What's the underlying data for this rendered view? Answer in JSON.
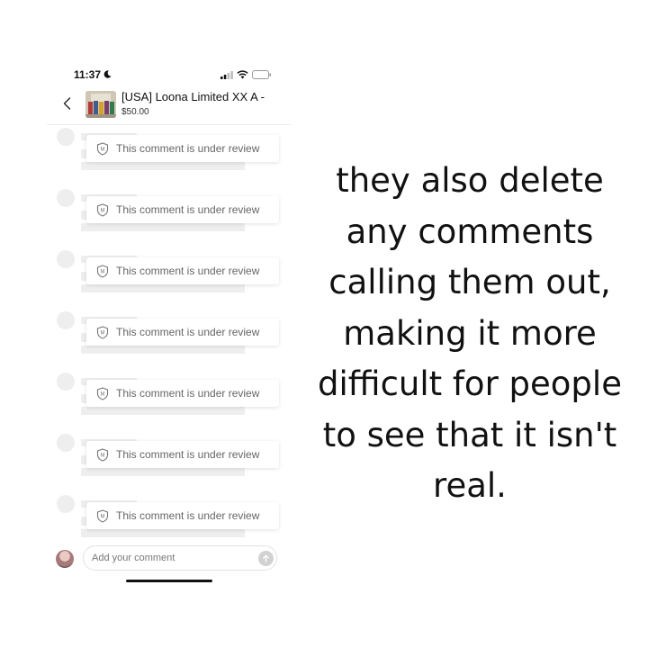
{
  "status_bar": {
    "time": "11:37"
  },
  "header": {
    "title": "[USA] Loona Limited XX A -",
    "price": "$50.00"
  },
  "comments": [
    {
      "text": "This comment is under review"
    },
    {
      "text": "This comment is under review"
    },
    {
      "text": "This comment is under review"
    },
    {
      "text": "This comment is under review"
    },
    {
      "text": "This comment is under review"
    },
    {
      "text": "This comment is under review"
    },
    {
      "text": "This comment is under review"
    }
  ],
  "composer": {
    "placeholder": "Add your comment"
  },
  "caption": {
    "lines": [
      "they also delete",
      "any comments",
      "calling them out,",
      "making it more",
      "difficult for people",
      "to see that it isn't",
      "real."
    ]
  },
  "icons": {
    "back": "chevron-left-icon",
    "shield": "shield-icon",
    "send": "arrow-up-icon",
    "moon": "moon-icon",
    "signal": "signal-icon",
    "wifi": "wifi-icon",
    "battery": "battery-icon"
  },
  "colors": {
    "placeholder_gray": "#eeeeee",
    "review_text": "#666666",
    "send_button": "#d2d2d2"
  }
}
